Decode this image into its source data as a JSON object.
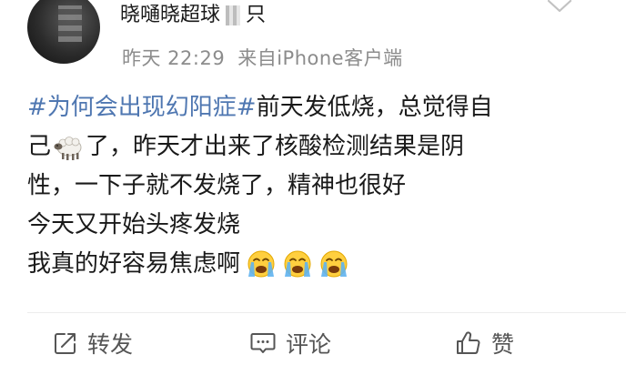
{
  "post": {
    "username_parts": [
      "晓嗵晓超球",
      "只"
    ],
    "timestamp": "昨天 22:29",
    "source": "来自iPhone客户端",
    "hashtag": "#为何会出现幻阳症#",
    "line1_text": "前天发低烧，总觉得自",
    "line2_pre": "己",
    "line2_post": "了，昨天才出来了核酸检测结果是阴",
    "line3": "性，一下子就不发烧了，精神也很好",
    "line4": "今天又开始头疼发烧",
    "line5": "我真的好容易焦虑啊",
    "emojis": {
      "sheep": "sheep-emoji",
      "crying": "loudly-crying-face-emoji",
      "crying_count": 3
    }
  },
  "actions": {
    "repost_label": "转发",
    "comment_label": "评论",
    "like_label": "赞"
  },
  "colors": {
    "hashtag": "#4f77b1",
    "meta_text": "#8c8c8c",
    "body_text": "#1a1a1a",
    "action_text": "#555555"
  }
}
